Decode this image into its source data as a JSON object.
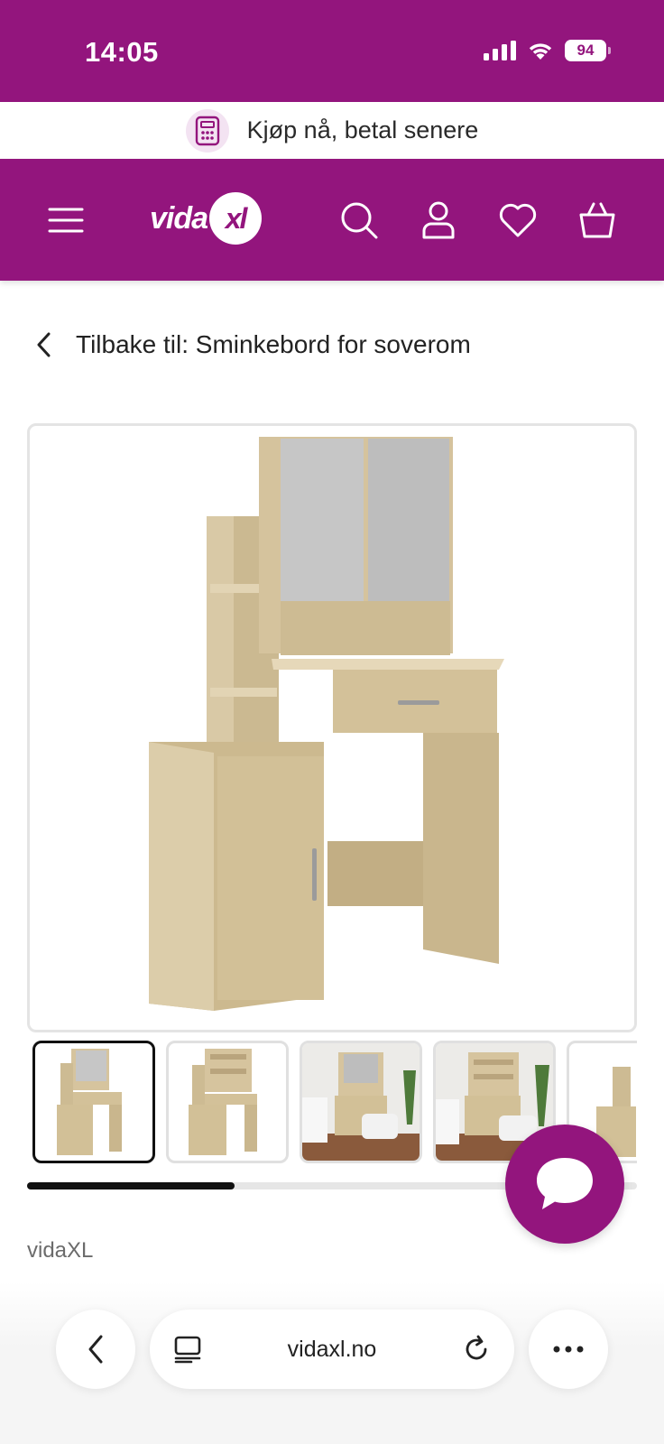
{
  "colors": {
    "brand": "#93157d"
  },
  "status_bar": {
    "time": "14:05",
    "battery": "94",
    "icons": [
      "signal-icon",
      "wifi-icon",
      "battery-icon"
    ]
  },
  "promo": {
    "text": "Kjøp nå, betal senere",
    "icon": "calculator-icon"
  },
  "header": {
    "logo_text": "vida",
    "logo_badge": "xl",
    "icons": [
      "menu-icon",
      "search-icon",
      "account-icon",
      "wishlist-heart-icon",
      "cart-basket-icon"
    ]
  },
  "breadcrumb": {
    "text": "Tilbake til: Sminkebord for soverom",
    "icon": "chevron-left-icon"
  },
  "gallery": {
    "main_image": "dressing-table-with-mirror-sonoma-oak",
    "thumbnails": [
      "front-view",
      "open-view",
      "bedroom-scene",
      "bedroom-scene-open",
      "side-view"
    ],
    "selected_index": 0,
    "scroll_progress": 0.34
  },
  "product": {
    "brand": "vidaXL"
  },
  "chat": {
    "icon": "chat-bubble-icon"
  },
  "browser": {
    "url": "vidaxl.no",
    "icons": [
      "back-icon",
      "tabs-reader-icon",
      "reload-icon",
      "more-icon"
    ]
  }
}
